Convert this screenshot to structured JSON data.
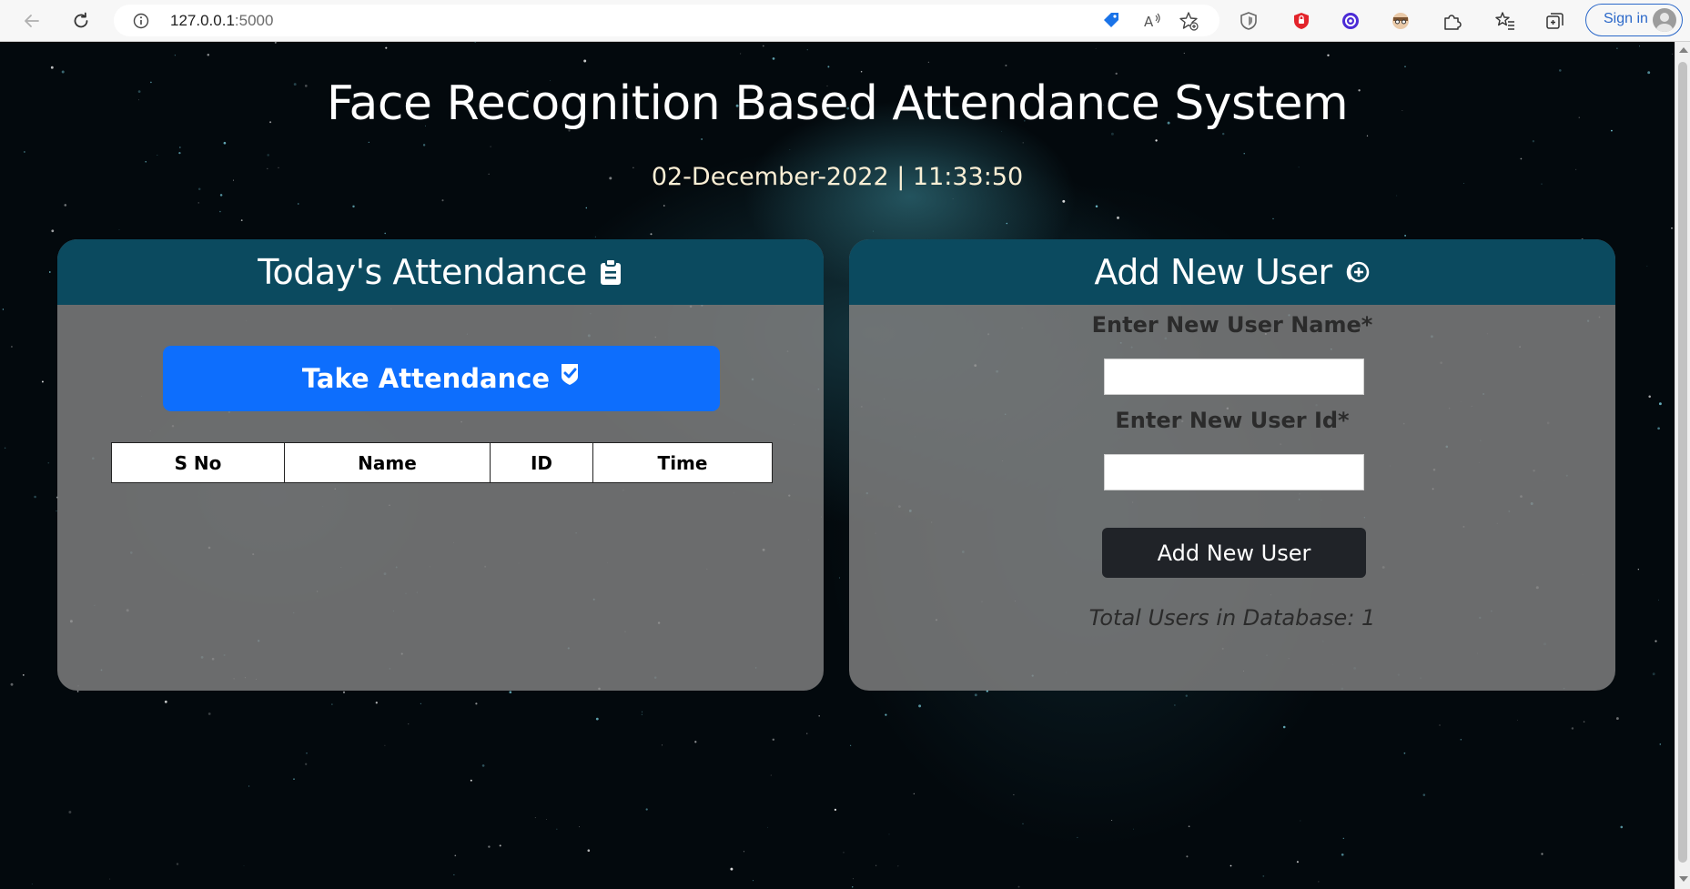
{
  "browser": {
    "url_host": "127.0.0.1",
    "url_port": ":5000",
    "signin_label": "Sign in"
  },
  "page": {
    "title": "Face Recognition Based Attendance System",
    "datetime": "02-December-2022 | 11:33:50"
  },
  "attendance_card": {
    "title": "Today's Attendance",
    "take_button_label": "Take Attendance",
    "table_headers": [
      "S No",
      "Name",
      "ID",
      "Time"
    ]
  },
  "add_user_card": {
    "title": "Add New User",
    "name_label": "Enter New User Name*",
    "name_value": "",
    "id_label": "Enter New User Id*",
    "id_value": "",
    "button_label": "Add New User",
    "total_users_text": "Total Users in Database: 1"
  },
  "colors": {
    "header_teal": "#0b4a5f",
    "primary_button": "#0d6efd",
    "dark_button": "#202328",
    "card_gray": "#808080",
    "datetime_text": "#fbefd5"
  },
  "icons": {
    "attendance_header": "clipboard-icon",
    "take_button": "check-badge-icon",
    "add_user_header": "plus-circle-icon"
  }
}
